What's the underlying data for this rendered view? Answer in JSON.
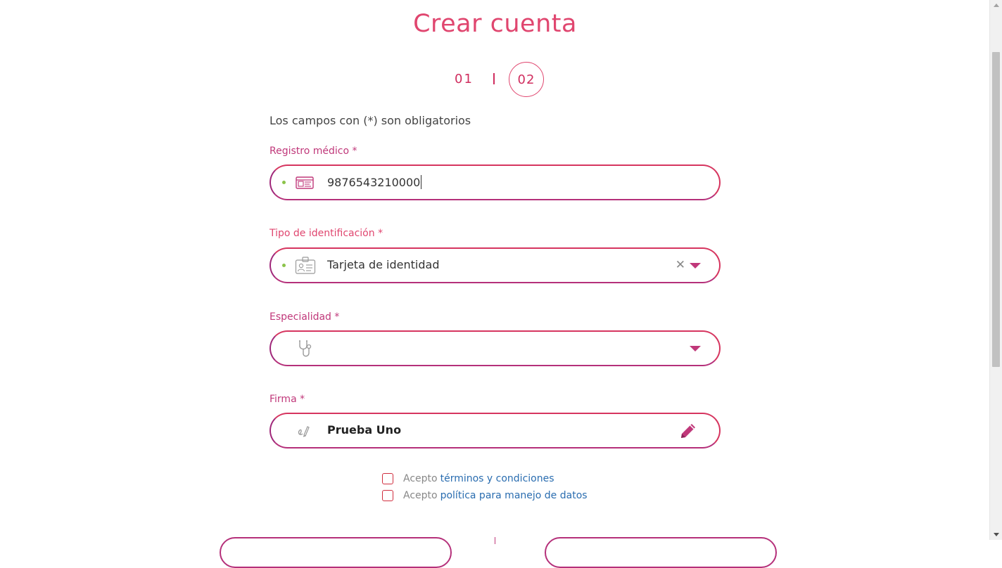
{
  "page": {
    "title": "Crear cuenta"
  },
  "stepper": {
    "step1": "01",
    "step2": "02",
    "current_step": 2
  },
  "form": {
    "required_note": "Los campos con (*) son obligatorios",
    "registro": {
      "label": "Registro médico *",
      "value": "9876543210000",
      "icon": "medical-card-icon"
    },
    "tipo_id": {
      "label": "Tipo de identificación *",
      "value": "Tarjeta de identidad",
      "icon": "id-badge-icon"
    },
    "especialidad": {
      "label": "Especialidad *",
      "value": "",
      "icon": "stethoscope-icon"
    },
    "firma": {
      "label": "Firma *",
      "value": "Prueba Uno",
      "icon": "signature-icon"
    }
  },
  "terms": [
    {
      "prefix": "Acepto",
      "link": "términos y condiciones",
      "checked": false
    },
    {
      "prefix": "Acepto",
      "link": "política para manejo de datos",
      "checked": false
    }
  ],
  "colors": {
    "accent": "#e0466f",
    "label": "#c0387a",
    "link": "#2a6db0",
    "valid_dot": "#8bc34a"
  }
}
